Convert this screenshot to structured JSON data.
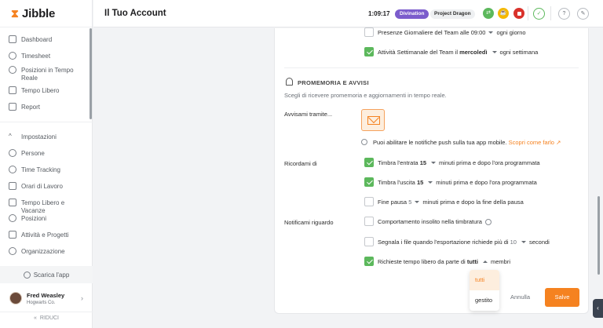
{
  "app": {
    "logo_mark": "⧗",
    "logo_text": "Jibble"
  },
  "sidebar": {
    "items": [
      {
        "label": "Dashboard",
        "icon": "dashboard-icon"
      },
      {
        "label": "Timesheet",
        "icon": "clock-icon"
      },
      {
        "label": "Posizioni in Tempo Reale",
        "icon": "location-pin-icon"
      },
      {
        "label": "Tempo Libero",
        "icon": "suitcase-icon"
      },
      {
        "label": "Report",
        "icon": "report-icon"
      }
    ],
    "settings_items": [
      {
        "label": "Impostazioni",
        "icon": "chevron-up-icon"
      },
      {
        "label": "Persone",
        "icon": "people-icon"
      },
      {
        "label": "Time Tracking",
        "icon": "stopwatch-icon"
      },
      {
        "label": "Orari di Lavoro",
        "icon": "schedule-icon"
      },
      {
        "label": "Tempo Libero e Vacanze",
        "icon": "vacation-icon"
      },
      {
        "label": "Posizioni",
        "icon": "location-pin-icon"
      },
      {
        "label": "Attività e Progetti",
        "icon": "tag-icon"
      },
      {
        "label": "Organizzazione",
        "icon": "gear-icon"
      }
    ],
    "download_label": "Scarica l'app",
    "user": {
      "name": "Fred Weasley",
      "org": "Hogwarts Co."
    },
    "collapse_label": "RIDUCI"
  },
  "header": {
    "title": "Il Tuo Account",
    "timer": "1:09:17",
    "activity": "Divination",
    "project": "Project Dragon",
    "colors": {
      "activity": "#7b5ccc",
      "green": "#5cb85c",
      "yellow": "#f5b800",
      "red": "#d9322b"
    }
  },
  "notifications": {
    "team_daily": {
      "label": "Presenze Giornaliere del Team alle",
      "time": "09:00",
      "suffix": "ogni giorno",
      "checked": false
    },
    "team_weekly": {
      "label": "Attività Settimanale del Team il",
      "day": "mercoledì",
      "suffix": "ogni settimana",
      "checked": true
    }
  },
  "reminders": {
    "section_title": "PROMEMORIA E AVVISI",
    "description": "Scegli di ricevere promemoria e aggiornamenti in tempo reale.",
    "notify_via_label": "Avvisami tramite...",
    "push_info": "Puoi abilitare le notifiche push sulla tua app mobile.",
    "push_link": "Scopri come farlo",
    "remind_me_label": "Ricordami di",
    "clock_in": {
      "prefix": "Timbra l'entrata",
      "value": "15",
      "suffix": "minuti prima e dopo l'ora programmata",
      "checked": true
    },
    "clock_out": {
      "prefix": "Timbra l'uscita",
      "value": "15",
      "suffix": "minuti prima e dopo l'ora programmata",
      "checked": true
    },
    "break_end": {
      "prefix": "Fine pausa",
      "value": "5",
      "suffix": "minuti prima e dopo la fine della pausa",
      "checked": false
    },
    "notify_about_label": "Notificami riguardo",
    "unusual": {
      "label": "Comportamento insolito nella timbratura",
      "checked": false
    },
    "export": {
      "prefix": "Segnala i file quando l'esportazione richiede più di",
      "value": "10",
      "suffix": "secondi",
      "checked": false
    },
    "timeoff": {
      "prefix": "Richieste tempo libero da parte di",
      "value": "tutti",
      "suffix": "membri",
      "checked": true
    }
  },
  "dropdown": {
    "options": [
      "tutti",
      "gestito"
    ],
    "selected": "tutti"
  },
  "actions": {
    "cancel": "Annulla",
    "save": "Salve"
  }
}
